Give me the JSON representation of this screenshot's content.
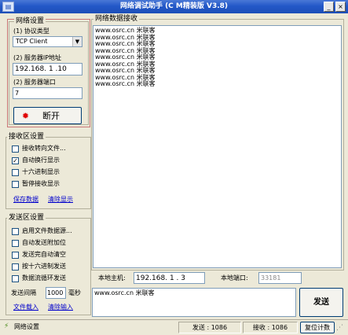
{
  "window": {
    "title": "网络调试助手  (C M精装版 V3.8)",
    "icon": "app-icon"
  },
  "network_settings": {
    "title": "网络设置",
    "protocol_label": "(1) 协议类型",
    "protocol_value": "TCP Client",
    "ip_label": "(2) 服务器IP地址",
    "ip_value": "192.168. 1 .10",
    "port_label": "(2) 服务器端口",
    "port_value": "7",
    "connect_button": "断开"
  },
  "receive_settings": {
    "title": "接收区设置",
    "options": [
      {
        "label": "接收转向文件...",
        "checked": false
      },
      {
        "label": "自动换行显示",
        "checked": true
      },
      {
        "label": "十六进制显示",
        "checked": false
      },
      {
        "label": "暂停接收显示",
        "checked": false
      }
    ],
    "save_link": "保存数据",
    "clear_link": "清除显示"
  },
  "send_settings": {
    "title": "发送区设置",
    "options": [
      {
        "label": "启用文件数据源...",
        "checked": false
      },
      {
        "label": "自动发送附加位",
        "checked": false
      },
      {
        "label": "发送完自动清空",
        "checked": false
      },
      {
        "label": "按十六进制发送",
        "checked": false
      },
      {
        "label": "数据流循环发送",
        "checked": false
      }
    ],
    "interval_label": "发送间隔",
    "interval_value": "1000",
    "interval_unit": "毫秒",
    "file_link": "文件载入",
    "clear_input_link": "清除输入"
  },
  "receive_area": {
    "title": "网络数据接收",
    "lines": [
      "www.osrc.cn 米联客",
      "www.osrc.cn 米联客",
      "www.osrc.cn 米联客",
      "www.osrc.cn 米联客",
      "www.osrc.cn 米联客",
      "www.osrc.cn 米联客",
      "www.osrc.cn 米联客",
      "www.osrc.cn 米联客",
      "www.osrc.cn 米联客"
    ]
  },
  "host_bar": {
    "local_host_label": "本地主机:",
    "local_host_value": "192.168. 1 . 3",
    "local_port_label": "本地端口:",
    "local_port_value": "33181"
  },
  "send_area": {
    "text": "www.osrc.cn 米联客",
    "send_button": "发送"
  },
  "status_bar": {
    "ready_text": "网络设置",
    "send_count": "发送 : 1086",
    "recv_count": "接收 : 1086",
    "reset_button": "复位计数"
  },
  "colors": {
    "title_bar": "#2358c8",
    "window_bg": "#ece9d8",
    "accent_frame": "#c97777"
  }
}
